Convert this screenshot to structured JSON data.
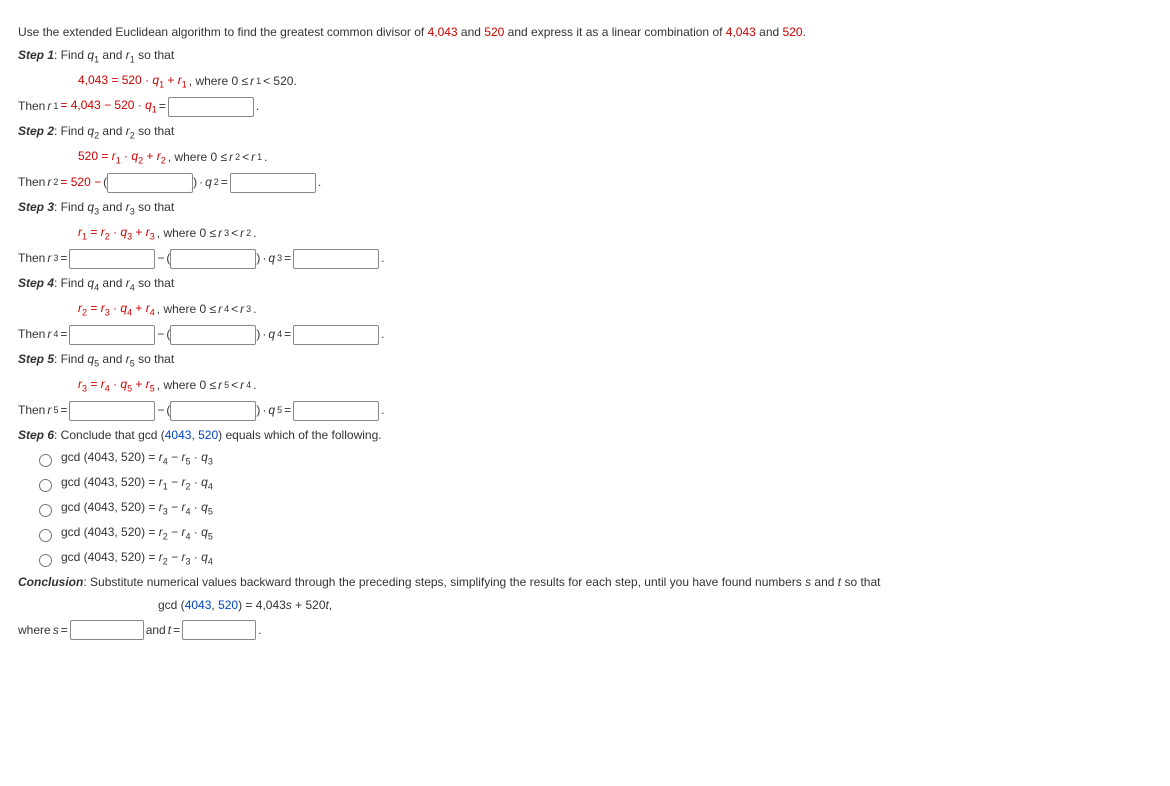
{
  "intro": {
    "p1": "Use the extended Euclidean algorithm to find the greatest common divisor of ",
    "a": "4,043",
    "and": " and ",
    "b": "520",
    "p2": " and express it as a linear combination of ",
    "p3": "."
  },
  "s1": {
    "title": "Step 1",
    "find": ": Find ",
    "so": " so that",
    "eq_a": "4,043 = 520 · ",
    "eq_b": ",  where  0 ≤ ",
    "eq_c": " < 520.",
    "then": "Then ",
    "mid": " = 4,043 − 520 · ",
    "eq": " = ",
    "dot": "."
  },
  "s2": {
    "title": "Step 2",
    "find": ": Find ",
    "so": " so that",
    "eq_a": "520 = ",
    "eq_mid": ",  where  0 ≤ ",
    "then": "Then ",
    "pre": " = 520 − ",
    "dot": " · ",
    "eq": " = ",
    "period": "."
  },
  "s3": {
    "title": "Step 3",
    "find": ": Find ",
    "so": " so that",
    "eq_a": ",  where  0 ≤ ",
    "then": "Then ",
    "eq": " = ",
    "minus": " − ",
    "dot": " · ",
    "period": "."
  },
  "s4": {
    "title": "Step 4",
    "find": ": Find ",
    "so": " so that",
    "eq_a": ",  where  0 ≤ ",
    "then": "Then ",
    "eq": " = ",
    "minus": " − ",
    "dot": " · ",
    "period": "."
  },
  "s5": {
    "title": "Step 5",
    "find": ": Find ",
    "so": " so that",
    "eq_a": ",  where  0 ≤ ",
    "then": "Then ",
    "eq": " = ",
    "minus": " − ",
    "dot": " · ",
    "period": "."
  },
  "s6": {
    "title": "Step 6",
    "txt": ": Conclude that gcd (",
    "a": "4043",
    ", ": ", ",
    "b": "520",
    "end": ") equals which of the following."
  },
  "opts": {
    "pre": "gcd (4043, 520) = ",
    "o1": " · ",
    "a": {
      "l": "r",
      "ls": "4",
      "m": " − ",
      "r": "r",
      "rs": "5",
      "q": "q",
      "qs": "3"
    },
    "b": {
      "l": "r",
      "ls": "1",
      "m": " − ",
      "r": "r",
      "rs": "2",
      "q": "q",
      "qs": "4"
    },
    "c": {
      "l": "r",
      "ls": "3",
      "m": " − ",
      "r": "r",
      "rs": "4",
      "q": "q",
      "qs": "5"
    },
    "d": {
      "l": "r",
      "ls": "2",
      "m": " − ",
      "r": "r",
      "rs": "4",
      "q": "q",
      "qs": "5"
    },
    "e": {
      "l": "r",
      "ls": "2",
      "m": " − ",
      "r": "r",
      "rs": "3",
      "q": "q",
      "qs": "4"
    }
  },
  "conc": {
    "title": "Conclusion",
    "txt": ": Substitute numerical values backward through the preceding steps, simplifying the results for each step, until you have found numbers ",
    "and": " and ",
    "end": " so that",
    "eq1": "gcd (",
    "a": "4043",
    ", ": ", ",
    "b": "520",
    "eq2": ") = 4,043",
    "plus": " + 520",
    "comma": ",",
    "where": "where ",
    "weq": " = ",
    "wand": " and ",
    "period": "."
  },
  "v": {
    "q": "q",
    "r": "r",
    "s": "s",
    "t": "t",
    "lt": " < ",
    "dot": ".",
    "plus": " + "
  }
}
